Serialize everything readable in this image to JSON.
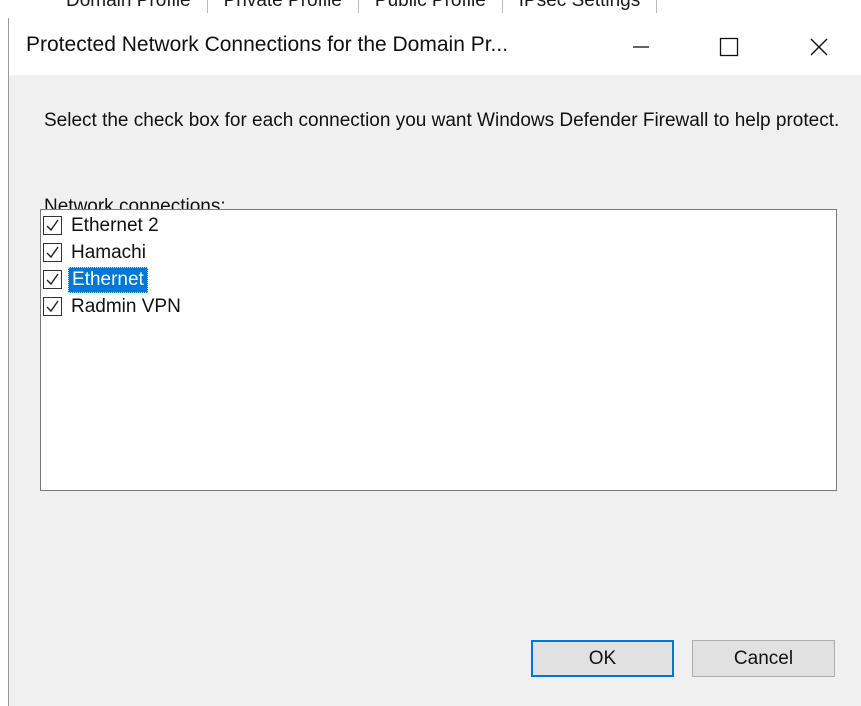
{
  "background_window": {
    "tabs": [
      "Domain Profile",
      "Private Profile",
      "Public Profile",
      "IPsec Settings"
    ]
  },
  "dialog": {
    "title": "Protected Network Connections for the Domain Pr...",
    "intro_text": "Select the check box for each connection you want Windows Defender Firewall to help protect.",
    "list_label": "Network connections:",
    "connections": [
      {
        "label": "Ethernet 2",
        "checked": true,
        "selected": false
      },
      {
        "label": "Hamachi",
        "checked": true,
        "selected": false
      },
      {
        "label": "Ethernet",
        "checked": true,
        "selected": true
      },
      {
        "label": "Radmin VPN",
        "checked": true,
        "selected": false
      }
    ],
    "ok_label": "OK",
    "cancel_label": "Cancel"
  },
  "icons": {
    "minimize": "minimize-icon",
    "maximize": "maximize-icon",
    "close": "close-icon",
    "check": "checkmark-icon"
  },
  "colors": {
    "selection": "#0078d7",
    "dialog_bg": "#f0f0f0",
    "default_button_border": "#0078d7"
  }
}
